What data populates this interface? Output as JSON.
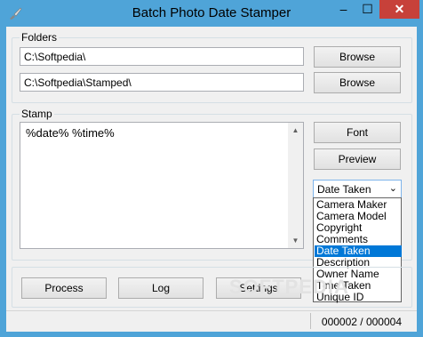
{
  "window": {
    "title": "Batch Photo Date Stamper",
    "minimize_glyph": "–",
    "maximize_glyph": "☐",
    "close_glyph": "✕"
  },
  "folders": {
    "label": "Folders",
    "source_path": "C:\\Softpedia\\",
    "output_path": "C:\\Softpedia\\Stamped\\",
    "browse_label": "Browse"
  },
  "stamp": {
    "label": "Stamp",
    "text": "%date% %time%",
    "font_label": "Font",
    "preview_label": "Preview",
    "field_selected": "Date Taken",
    "field_options": [
      "Camera Maker",
      "Camera Model",
      "Copyright",
      "Comments",
      "Date Taken",
      "Description",
      "Owner Name",
      "Time Taken",
      "Unique ID"
    ]
  },
  "actions": {
    "process_label": "Process",
    "log_label": "Log",
    "settings_label": "Settings"
  },
  "status": {
    "counter": "000002 / 000004"
  },
  "watermark": "SOFTPEDIA",
  "colors": {
    "title_bar": "#4fa4d8",
    "close_button": "#c7413a",
    "selection": "#0078d7"
  },
  "icons": {
    "app": "brush-icon",
    "scroll_up": "scroll-up-arrow-icon",
    "scroll_down": "scroll-down-arrow-icon",
    "dropdown": "chevron-down-icon"
  }
}
